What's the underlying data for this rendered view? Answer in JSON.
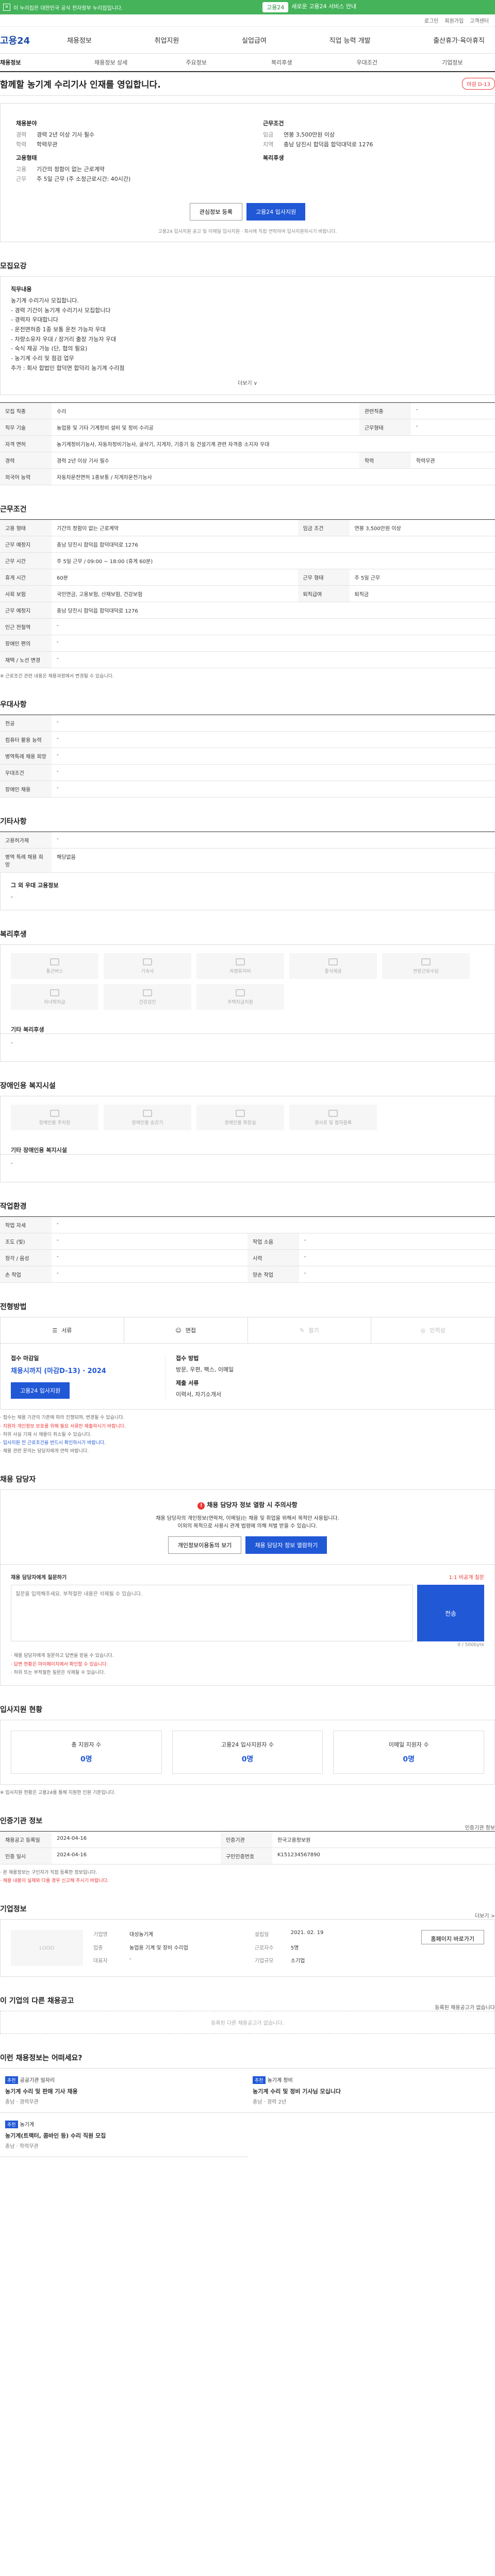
{
  "topbar": {
    "left_text": "이 누리집은 대한민국 공식 전자정부 누리집입니다.",
    "center_pill": "고용24",
    "center_text": "새로운 고용24 서비스 안내"
  },
  "util": {
    "items": [
      "로그인",
      "회원가입",
      "고객센터"
    ]
  },
  "gnb": {
    "logo": "고용24",
    "menu": [
      "채용정보",
      "취업지원",
      "실업급여",
      "직업 능력 개발",
      "출산휴가·육아휴직"
    ]
  },
  "subnav": [
    "채용정보",
    "채용정보 상세",
    "주요정보",
    "복리후생",
    "우대조건",
    "기업정보"
  ],
  "title": {
    "text": "함께할 농기계 수리기사 인재를 영입합니다.",
    "badge": "마감 D-13"
  },
  "summary": {
    "left_label": "채용분야",
    "left_rows": [
      {
        "k": "경력",
        "v": "경력 2년 이상 기사 필수"
      },
      {
        "k": "학력",
        "v": "학력무관"
      }
    ],
    "left_label2": "고용형태",
    "left_rows2": [
      {
        "k": "고용",
        "v": "기간의 정함이 없는 근로계약"
      },
      {
        "k": "근무",
        "v": "주 5일 근무 (주 소정근로시간: 40시간)"
      }
    ],
    "right_label": "근무조건",
    "right_rows": [
      {
        "k": "임금",
        "v": "연봉 3,500만원 이상"
      },
      {
        "k": "지역",
        "v": "충남 당진시 합덕읍 합덕대덕로 1276"
      }
    ],
    "right_label2": "복리후생",
    "bookmark_btn": "관심정보 등록",
    "apply_btn": "고용24 입사지원",
    "notice": "고용24 입사지원 공고 및 이메일 입사지원 · 회사에 직접 연락하여 입사지원하시기 바랍니다."
  },
  "recruit": {
    "heading": "모집요강",
    "intro_label": "직무내용",
    "intro_lines": [
      "농기계 수리기사 모집합니다.",
      "- 경력 기간이 농기계 수리기사 모집합니다",
      "- 경력자 우대합니다",
      "- 운전면허증 1종 보통 운전 가능자 우대",
      "- 차량소유자 우대 / 장거리 출장 가능자 우대",
      "- 숙식 제공 가능 (단, 협의 필요)",
      "- 농기계 수리 및 점검 업무",
      "추가 : 회사 합법인 합덕면 합덕리 농기계 수리점"
    ],
    "more": "더보기 ∨",
    "rows": [
      {
        "k": "모집 직종",
        "v": "수리",
        "k2": "관련직종",
        "v2": "-"
      },
      {
        "k": "직무 기술",
        "v": "농업용 및 기타 기계정비 설비 및 정비 수리공",
        "k2": "근무형태",
        "v2": "-"
      },
      {
        "k": "자격 면허",
        "v": "농기계정비기능사, 자동차정비기능사, 굴삭기, 지게차, 기중기 등 건설기계 관련 자격증 소지자 우대",
        "k2": "",
        "v2": ""
      },
      {
        "k": "경력",
        "v": "경력 2년 이상 기사 필수",
        "k2": "학력",
        "v2": "학력무관"
      },
      {
        "k": "외국어 능력",
        "v": "자동차운전면허 1종보통 / 지게차운전기능사",
        "k2": "",
        "v2": ""
      }
    ]
  },
  "conditions": {
    "heading": "근무조건",
    "rows": [
      {
        "k": "고용 형태",
        "v": "기간의 정함이 없는 근로계약",
        "k2": "임금 조건",
        "v2": "연봉 3,500만원 이상"
      },
      {
        "k": "근무 예정지",
        "v": "충남 당진시 합덕읍 합덕대덕로 1276",
        "k2": "",
        "v2": ""
      },
      {
        "k": "근무 시간",
        "v": "주 5일 근무 / 09:00 ~ 18:00 (휴게 60분)",
        "k2": "",
        "v2": ""
      },
      {
        "k": "휴게 시간",
        "v": "60분",
        "k2": "근무 형태",
        "v2": "주 5일 근무"
      },
      {
        "k": "사회 보험",
        "v": "국민연금, 고용보험, 산재보험, 건강보험",
        "k2": "퇴직급여",
        "v2": "퇴직금"
      },
      {
        "k": "근무 예정지",
        "v": "충남 당진시 합덕읍 합덕대덕로 1276",
        "k2": "",
        "v2": ""
      },
      {
        "k": "인근 전철역",
        "v": "-",
        "k2": "",
        "v2": ""
      },
      {
        "k": "장애인 편의",
        "v": "-",
        "k2": "",
        "v2": ""
      },
      {
        "k": "재택 / 노선 변경",
        "v": "-",
        "k2": "",
        "v2": ""
      }
    ],
    "footnote": "※ 근로조건 관련 내용은 채용과정에서 변경될 수 있습니다."
  },
  "prefer": {
    "heading": "우대사항",
    "rows": [
      {
        "k": "전공",
        "v": "-"
      },
      {
        "k": "컴퓨터 활용 능력",
        "v": "-"
      },
      {
        "k": "병역특례 채용 희망",
        "v": "-"
      },
      {
        "k": "우대조건",
        "v": "-"
      },
      {
        "k": "장애인 채용",
        "v": "-"
      }
    ]
  },
  "other": {
    "heading": "기타사항",
    "rows": [
      {
        "k": "고용허가제",
        "v": "-"
      },
      {
        "k": "병역 특례 채용 희망",
        "v": "해당없음"
      }
    ],
    "sub_label": "그 외 우대 고용정보",
    "sub_value": "-"
  },
  "welfare": {
    "heading": "복리후생",
    "tiles": [
      "통근버스",
      "기숙사",
      "차량유지비",
      "중식제공",
      "연장근로수당",
      "자녀학자금",
      "건강검진",
      "주택자금지원"
    ],
    "sub_label": "기타 복리후생",
    "sub_value": "-"
  },
  "disability": {
    "heading": "장애인용 복지시설",
    "tiles": [
      "장애인용 주차장",
      "장애인용 승강기",
      "장애인용 화장실",
      "경사로 및 점자블록"
    ],
    "sub_label": "기타 장애인용 복지시설",
    "sub_value": "-"
  },
  "environment": {
    "heading": "작업환경",
    "rows": [
      {
        "k": "작업 자세",
        "v": "-",
        "k2": "",
        "v2": ""
      },
      {
        "k": "조도 (빛)",
        "v": "-",
        "k2": "작업 소음",
        "v2": "-"
      },
      {
        "k": "청각 / 음성",
        "v": "-",
        "k2": "시력",
        "v2": "-"
      },
      {
        "k": "손 작업",
        "v": "-",
        "k2": "양손 작업",
        "v2": "-"
      }
    ]
  },
  "method": {
    "heading": "전형방법",
    "tabs": [
      "서류",
      "면접",
      "필기",
      "인적성"
    ],
    "deadline_label": "접수 마감일",
    "deadline_value": "채용시까지 (마감D-13) · 2024",
    "apply_btn": "고용24 입사지원",
    "method_label": "접수 방법",
    "method_value": "방문, 우편, 팩스, 이메일",
    "doc_label": "제출 서류",
    "doc_value": "이력서, 자기소개서",
    "notes": [
      "· 접수는 채용 기관의 기준에 따라 진행되며, 변경될 수 있습니다.",
      "· 지원자 개인정보 보호를 위해 필요 서류만 제출하시기 바랍니다.",
      "· 허위 사실 기재 시 채용이 취소될 수 있습니다.",
      "· 입사지원 전 근로조건을 반드시 확인하시기 바랍니다.",
      "· 채용 관련 문의는 담당자에게 연락 바랍니다."
    ]
  },
  "contact": {
    "heading": "채용 담당자",
    "warn": "채용 담당자 정보 열람 시 주의사항",
    "line1": "채용 담당자의 개인정보(연락처, 이메일)는 채용 및 취업을 위해서 목적만 사용됩니다.",
    "line2": "이외의 목적으로 사용시 관계 법령에 의해 처벌 받을 수 있습니다.",
    "btn1": "개인정보이용동의 보기",
    "btn2": "채용 담당자 정보 열람하기"
  },
  "inquiry": {
    "title": "채용 담당자에게 질문하기",
    "note": "1:1 비공개 질문",
    "placeholder": "질문을 입력해주세요. 부적절한 내용은 삭제될 수 있습니다.",
    "send": "전송",
    "counter": "0 / 500byte",
    "notes": [
      "· 채용 담당자에게 질문하고 답변을 받을 수 있습니다.",
      "· 답변 현황은 마이페이지에서 확인할 수 있습니다.",
      "· 허위 또는 부적절한 질문은 삭제될 수 있습니다."
    ]
  },
  "status": {
    "heading": "입사지원 현황",
    "items": [
      {
        "label": "총 지원자 수",
        "num": "0명"
      },
      {
        "label": "고용24 입사지원자 수",
        "num": "0명"
      },
      {
        "label": "이메일 지원자 수",
        "num": "0명"
      }
    ],
    "note": "※ 입사지원 현황은 고용24를 통해 지원한 인원 기준입니다."
  },
  "posting": {
    "heading": "인증기관 정보",
    "right_link": "인증기관 정보",
    "rows": [
      {
        "k": "채용공고 등록일",
        "v": "2024-04-16",
        "k2": "인증기관",
        "v2": "한국고용정보원"
      },
      {
        "k": "인증 일시",
        "v": "2024-04-16",
        "k2": "구인인증번호",
        "v2": "K151234567890"
      }
    ],
    "notes": [
      "· 본 채용정보는 구인자가 직접 등록한 정보입니다.",
      "· 채용 내용이 실제와 다를 경우 신고해 주시기 바랍니다."
    ]
  },
  "company": {
    "heading": "기업정보",
    "right_link": "더보기 >",
    "logo_ph": "LOGO",
    "fields": [
      {
        "k": "기업명",
        "v": "대성농기계"
      },
      {
        "k": "설립일",
        "v": "2021. 02. 19"
      },
      {
        "k": "업종",
        "v": "농업용 기계 및 장비 수리업"
      },
      {
        "k": "근로자수",
        "v": "5명"
      },
      {
        "k": "대표자",
        "v": "-"
      },
      {
        "k": "기업규모",
        "v": "소기업"
      }
    ],
    "homepage_btn": "홈페이지 바로가기"
  },
  "same_company": {
    "heading": "이 기업의 다른 채용공고",
    "right_link": "등록된 채용공고가 없습니다",
    "empty": "등록된 다른 채용공고가 없습니다."
  },
  "recommend": {
    "heading": "이런 채용정보는 어떠세요?",
    "cards": [
      {
        "tag": "추천",
        "org": "공공기관 일자리",
        "title": "농기계 수리 및 판매 기사 채용",
        "sub": "충남 · 경력무관"
      },
      {
        "tag": "추천",
        "org": "농기계 정비",
        "title": "농기계 수리 및 정비 기사님 모십니다",
        "sub": "충남 · 경력 2년"
      },
      {
        "tag": "추천",
        "org": "농기계",
        "title": "농기계(트랙터, 콤바인 등) 수리 직원 모집",
        "sub": "충남 · 학력무관"
      }
    ]
  }
}
